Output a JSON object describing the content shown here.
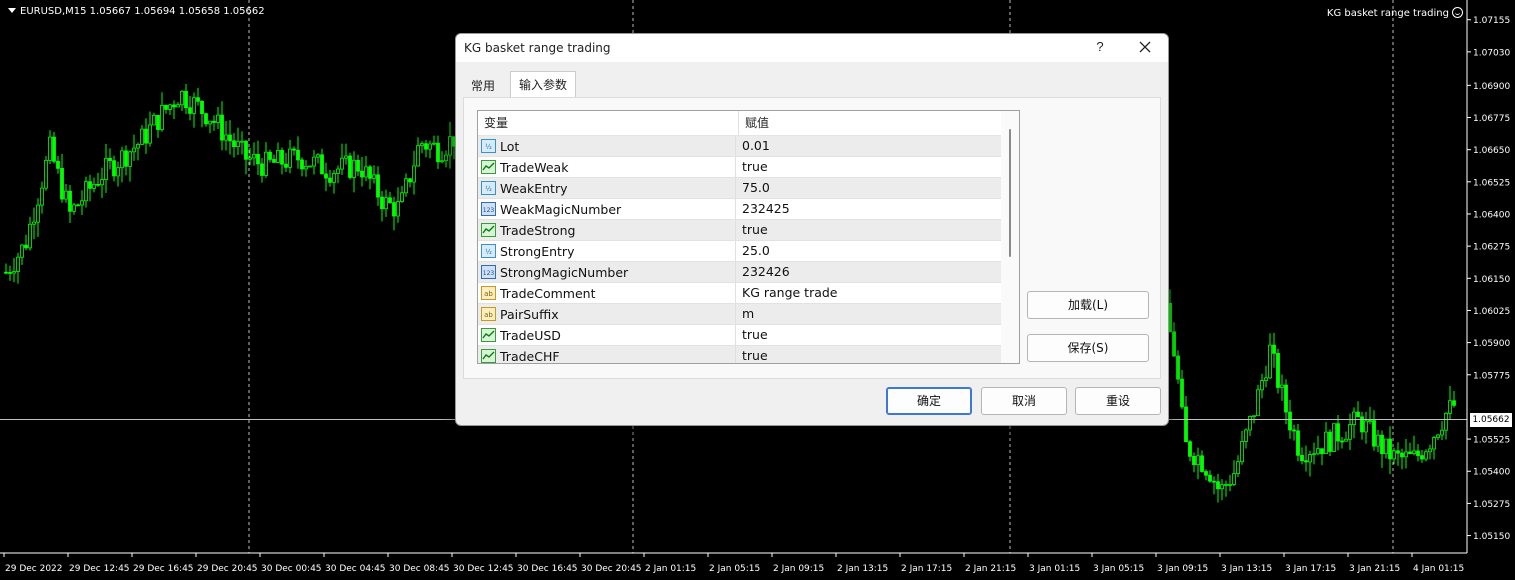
{
  "chart": {
    "symbol_line": "EURUSD,M15  1.05667 1.05694 1.05658 1.05662",
    "ea_label": "KG basket range trading",
    "current_price": "1.05662",
    "colors": {
      "background": "#000000",
      "candles": "#00ff00",
      "grid": "#c0c0c0",
      "text": "#ffffff"
    },
    "price_axis": [
      "1.07155",
      "1.07030",
      "1.06900",
      "1.06775",
      "1.06650",
      "1.06525",
      "1.06400",
      "1.06275",
      "1.06150",
      "1.06025",
      "1.05900",
      "1.05775",
      "1.05662",
      "1.05525",
      "1.05400",
      "1.05275",
      "1.05150"
    ],
    "time_axis": [
      "29 Dec 2022",
      "29 Dec 12:45",
      "29 Dec 16:45",
      "29 Dec 20:45",
      "30 Dec 00:45",
      "30 Dec 04:45",
      "30 Dec 08:45",
      "30 Dec 12:45",
      "30 Dec 16:45",
      "30 Dec 20:45",
      "2 Jan 01:15",
      "2 Jan 05:15",
      "2 Jan 09:15",
      "2 Jan 13:15",
      "2 Jan 17:15",
      "2 Jan 21:15",
      "3 Jan 01:15",
      "3 Jan 05:15",
      "3 Jan 09:15",
      "3 Jan 13:15",
      "3 Jan 17:15",
      "3 Jan 21:15",
      "4 Jan 01:15"
    ]
  },
  "dialog": {
    "title": "KG basket range trading",
    "help": "?",
    "tabs": [
      {
        "label": "常用",
        "active": false
      },
      {
        "label": "输入参数",
        "active": true
      }
    ],
    "table": {
      "headers": {
        "variable": "变量",
        "value": "赋值"
      },
      "rows": [
        {
          "type": "double",
          "name": "Lot",
          "value": "0.01"
        },
        {
          "type": "bool",
          "name": "TradeWeak",
          "value": "true"
        },
        {
          "type": "double",
          "name": "WeakEntry",
          "value": "75.0"
        },
        {
          "type": "int",
          "name": "WeakMagicNumber",
          "value": "232425"
        },
        {
          "type": "bool",
          "name": "TradeStrong",
          "value": "true"
        },
        {
          "type": "double",
          "name": "StrongEntry",
          "value": "25.0"
        },
        {
          "type": "int",
          "name": "StrongMagicNumber",
          "value": "232426"
        },
        {
          "type": "string",
          "name": "TradeComment",
          "value": "KG range trade"
        },
        {
          "type": "string",
          "name": "PairSuffix",
          "value": "m"
        },
        {
          "type": "bool",
          "name": "TradeUSD",
          "value": "true"
        },
        {
          "type": "bool",
          "name": "TradeCHF",
          "value": "true"
        }
      ]
    },
    "side_buttons": {
      "load": "加载(L)",
      "save": "保存(S)"
    },
    "buttons": {
      "ok": "确定",
      "cancel": "取消",
      "reset": "重设"
    },
    "icons": {
      "double": "double-param-icon",
      "bool": "bool-param-icon",
      "int": "int-param-icon",
      "string": "string-param-icon",
      "close": "close-icon",
      "help": "help-icon",
      "dropdown": "dropdown-triangle-icon",
      "smiley": "smiley-icon"
    }
  }
}
